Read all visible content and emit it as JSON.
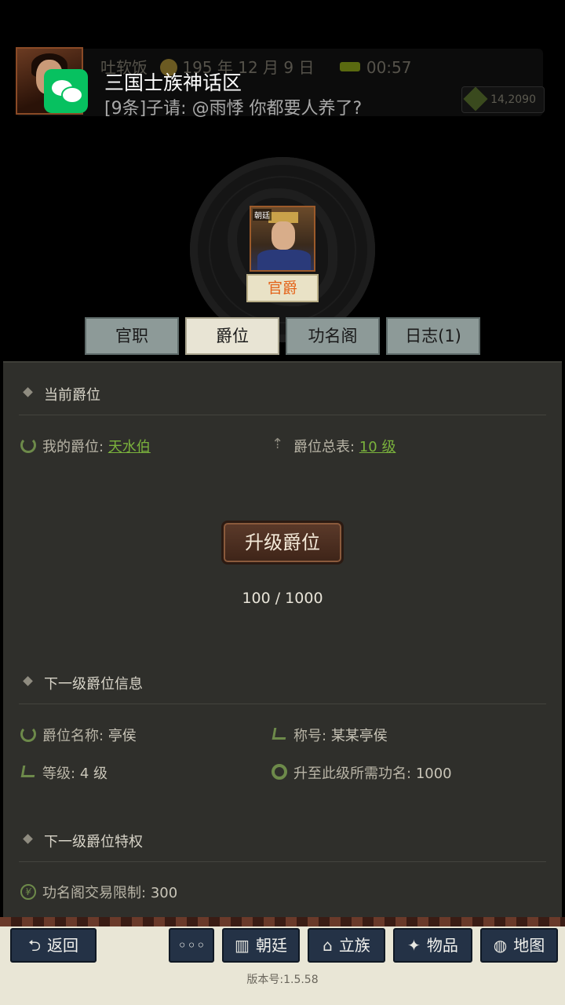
{
  "status": {
    "player_name": "吐软饭",
    "date": "195 年 12 月 9 日",
    "time": "00:57",
    "resource": "14,2090"
  },
  "notification": {
    "title": "三国士族神话区",
    "body": "[9条]子请: @雨悸 你都要人养了?"
  },
  "portrait": {
    "tag": "朝廷",
    "badge": "官爵"
  },
  "tabs": [
    {
      "label": "官职",
      "active": false
    },
    {
      "label": "爵位",
      "active": true
    },
    {
      "label": "功名阁",
      "active": false
    },
    {
      "label": "日志(1)",
      "active": false
    }
  ],
  "current": {
    "heading": "当前爵位",
    "my_rank_label": "我的爵位:",
    "my_rank_value": "天水伯",
    "table_label": "爵位总表:",
    "table_value": "10 级",
    "upgrade_button": "升级爵位",
    "progress": "100 / 1000"
  },
  "next_info": {
    "heading": "下一级爵位信息",
    "name_label": "爵位名称:",
    "name_value": "亭侯",
    "title_label": "称号:",
    "title_value": "某某亭侯",
    "level_label": "等级:",
    "level_value": "4 级",
    "req_label": "升至此级所需功名:",
    "req_value": "1000"
  },
  "next_privilege": {
    "heading": "下一级爵位特权",
    "trade_label": "功名阁交易限制:",
    "trade_value": "300"
  },
  "bottom_nav": {
    "back": "返回",
    "more": "◦◦◦",
    "court": "朝廷",
    "clan": "立族",
    "items": "物品",
    "map": "地图"
  },
  "version": "版本号:1.5.58"
}
